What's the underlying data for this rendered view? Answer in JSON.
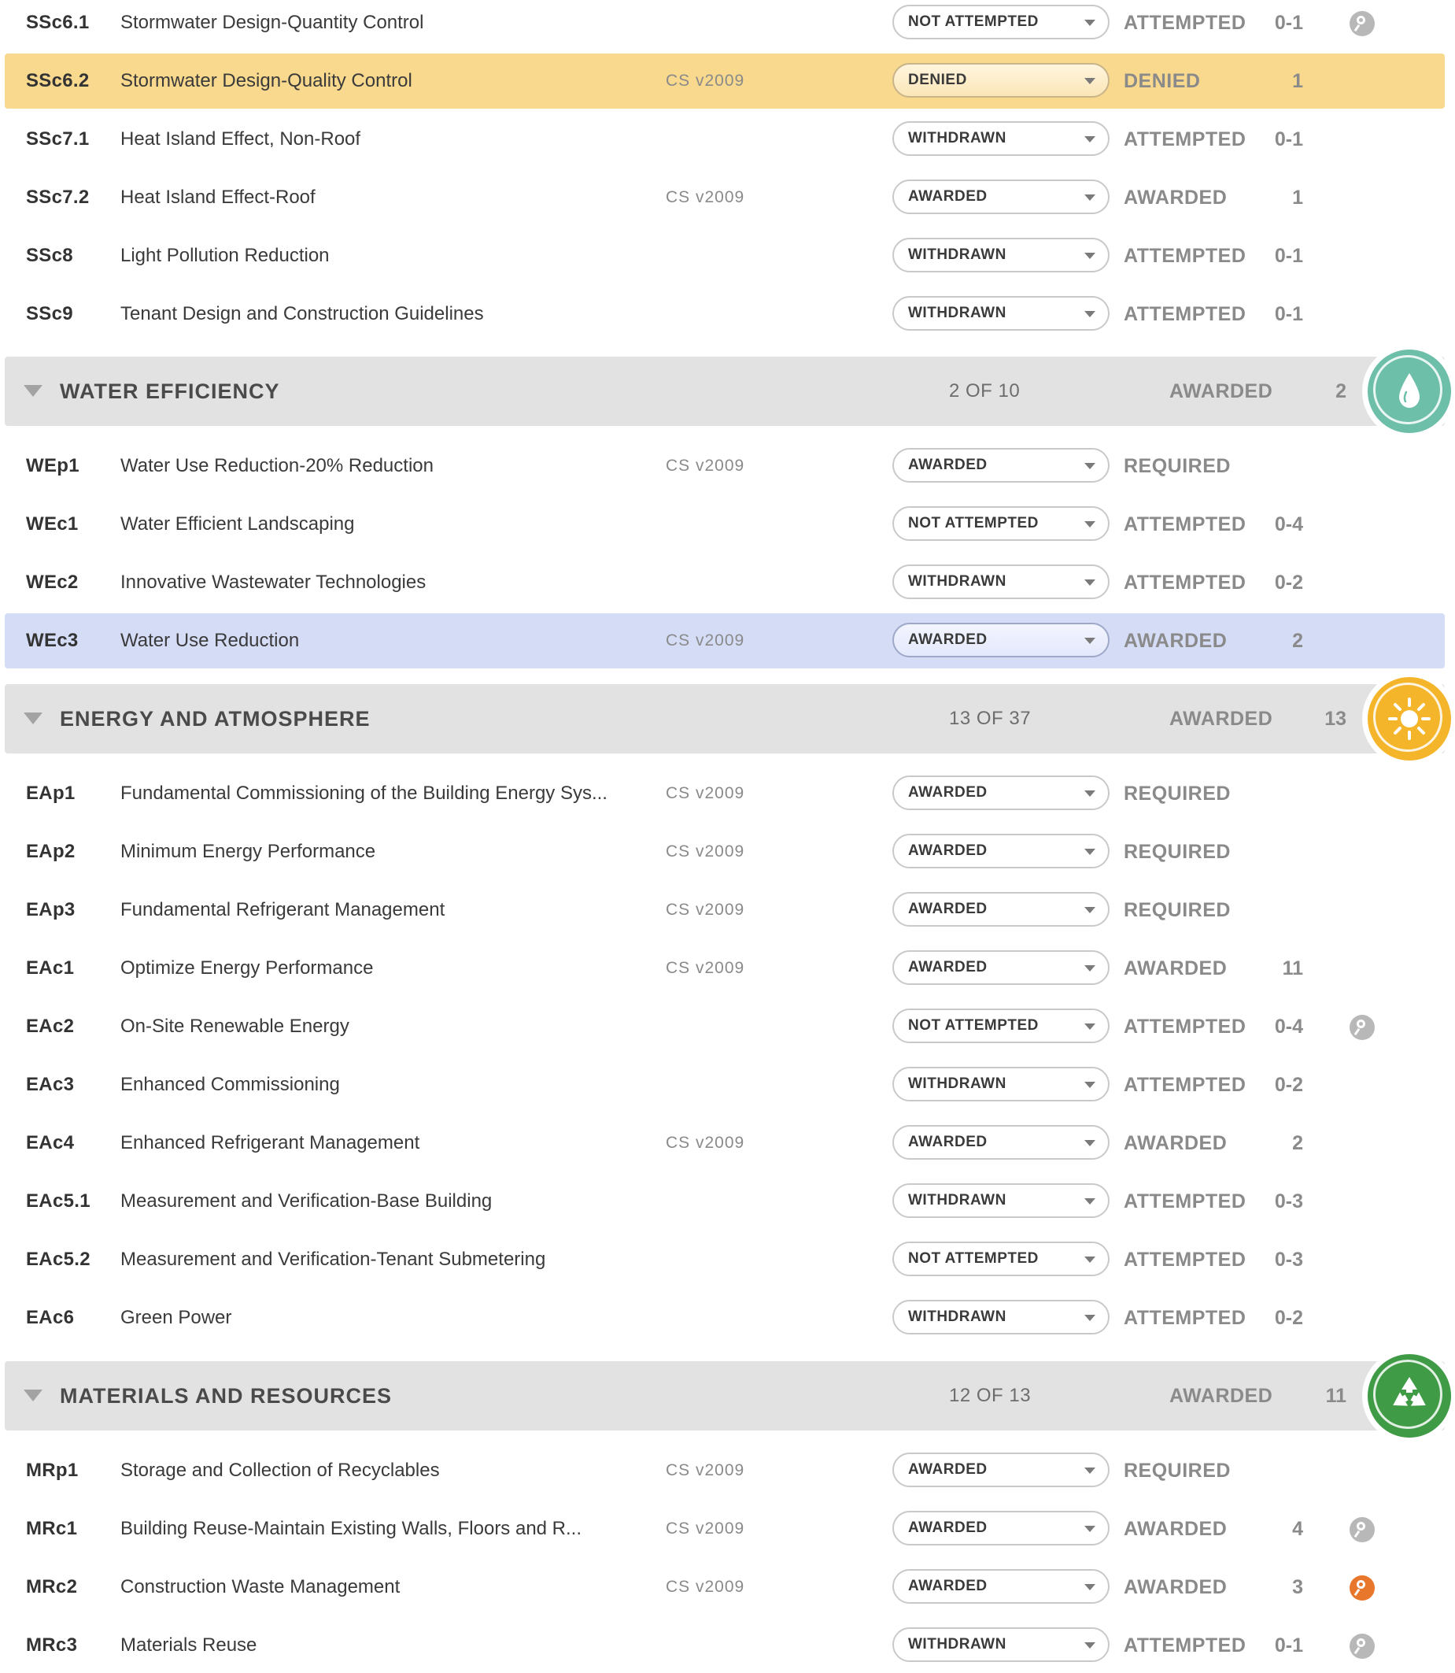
{
  "colors": {
    "highlight_denied": "#f8d98e",
    "highlight_selected": "#d5dcf6",
    "water_badge": "#6ebfaa",
    "energy_badge": "#f5b52a",
    "materials_badge": "#3f9b45",
    "info_icon_default": "#b8b8b8",
    "info_icon_active": "#e8762b"
  },
  "sections": [
    {
      "credits": [
        {
          "code": "SSc6.1",
          "name": "Stormwater Design-Quantity Control",
          "version": "",
          "selected": "NOT ATTEMPTED",
          "status": "ATTEMPTED",
          "points": "0-1",
          "icon": "search-icon"
        },
        {
          "code": "SSc6.2",
          "name": "Stormwater Design-Quality Control",
          "version": "CS v2009",
          "selected": "DENIED",
          "status": "DENIED",
          "points": "1",
          "highlight": "yellow"
        },
        {
          "code": "SSc7.1",
          "name": "Heat Island Effect, Non-Roof",
          "version": "",
          "selected": "WITHDRAWN",
          "status": "ATTEMPTED",
          "points": "0-1"
        },
        {
          "code": "SSc7.2",
          "name": "Heat Island Effect-Roof",
          "version": "CS v2009",
          "selected": "AWARDED",
          "status": "AWARDED",
          "points": "1"
        },
        {
          "code": "SSc8",
          "name": "Light Pollution Reduction",
          "version": "",
          "selected": "WITHDRAWN",
          "status": "ATTEMPTED",
          "points": "0-1"
        },
        {
          "code": "SSc9",
          "name": "Tenant Design and Construction Guidelines",
          "version": "",
          "selected": "WITHDRAWN",
          "status": "ATTEMPTED",
          "points": "0-1"
        }
      ]
    },
    {
      "title": "WATER EFFICIENCY",
      "count": "2 OF 10",
      "status": "AWARDED",
      "points": "2",
      "badge_icon": "water-drop-icon",
      "credits": [
        {
          "code": "WEp1",
          "name": "Water Use Reduction-20% Reduction",
          "version": "CS v2009",
          "selected": "AWARDED",
          "status": "REQUIRED",
          "points": ""
        },
        {
          "code": "WEc1",
          "name": "Water Efficient Landscaping",
          "version": "",
          "selected": "NOT ATTEMPTED",
          "status": "ATTEMPTED",
          "points": "0-4"
        },
        {
          "code": "WEc2",
          "name": "Innovative Wastewater Technologies",
          "version": "",
          "selected": "WITHDRAWN",
          "status": "ATTEMPTED",
          "points": "0-2"
        },
        {
          "code": "WEc3",
          "name": "Water Use Reduction",
          "version": "CS v2009",
          "selected": "AWARDED",
          "status": "AWARDED",
          "points": "2",
          "highlight": "blue"
        }
      ]
    },
    {
      "title": "ENERGY AND ATMOSPHERE",
      "count": "13 OF 37",
      "status": "AWARDED",
      "points": "13",
      "badge_icon": "sun-icon",
      "credits": [
        {
          "code": "EAp1",
          "name": "Fundamental Commissioning of the Building Energy Sys...",
          "version": "CS v2009",
          "selected": "AWARDED",
          "status": "REQUIRED",
          "points": ""
        },
        {
          "code": "EAp2",
          "name": "Minimum Energy Performance",
          "version": "CS v2009",
          "selected": "AWARDED",
          "status": "REQUIRED",
          "points": ""
        },
        {
          "code": "EAp3",
          "name": "Fundamental Refrigerant Management",
          "version": "CS v2009",
          "selected": "AWARDED",
          "status": "REQUIRED",
          "points": ""
        },
        {
          "code": "EAc1",
          "name": "Optimize Energy Performance",
          "version": "CS v2009",
          "selected": "AWARDED",
          "status": "AWARDED",
          "points": "11"
        },
        {
          "code": "EAc2",
          "name": "On-Site Renewable Energy",
          "version": "",
          "selected": "NOT ATTEMPTED",
          "status": "ATTEMPTED",
          "points": "0-4",
          "icon": "search-icon"
        },
        {
          "code": "EAc3",
          "name": "Enhanced Commissioning",
          "version": "",
          "selected": "WITHDRAWN",
          "status": "ATTEMPTED",
          "points": "0-2"
        },
        {
          "code": "EAc4",
          "name": "Enhanced Refrigerant Management",
          "version": "CS v2009",
          "selected": "AWARDED",
          "status": "AWARDED",
          "points": "2"
        },
        {
          "code": "EAc5.1",
          "name": "Measurement and Verification-Base Building",
          "version": "",
          "selected": "WITHDRAWN",
          "status": "ATTEMPTED",
          "points": "0-3"
        },
        {
          "code": "EAc5.2",
          "name": "Measurement and Verification-Tenant Submetering",
          "version": "",
          "selected": "NOT ATTEMPTED",
          "status": "ATTEMPTED",
          "points": "0-3"
        },
        {
          "code": "EAc6",
          "name": "Green Power",
          "version": "",
          "selected": "WITHDRAWN",
          "status": "ATTEMPTED",
          "points": "0-2"
        }
      ]
    },
    {
      "title": "MATERIALS AND RESOURCES",
      "count": "12 OF 13",
      "status": "AWARDED",
      "points": "11",
      "badge_icon": "recycle-icon",
      "credits": [
        {
          "code": "MRp1",
          "name": "Storage and Collection of Recyclables",
          "version": "CS v2009",
          "selected": "AWARDED",
          "status": "REQUIRED",
          "points": ""
        },
        {
          "code": "MRc1",
          "name": "Building Reuse-Maintain Existing Walls, Floors and R...",
          "version": "CS v2009",
          "selected": "AWARDED",
          "status": "AWARDED",
          "points": "4",
          "icon": "search-icon"
        },
        {
          "code": "MRc2",
          "name": "Construction Waste Management",
          "version": "CS v2009",
          "selected": "AWARDED",
          "status": "AWARDED",
          "points": "3",
          "icon": "search-icon-active"
        },
        {
          "code": "MRc3",
          "name": "Materials Reuse",
          "version": "",
          "selected": "WITHDRAWN",
          "status": "ATTEMPTED",
          "points": "0-1",
          "icon": "search-icon"
        }
      ]
    }
  ]
}
